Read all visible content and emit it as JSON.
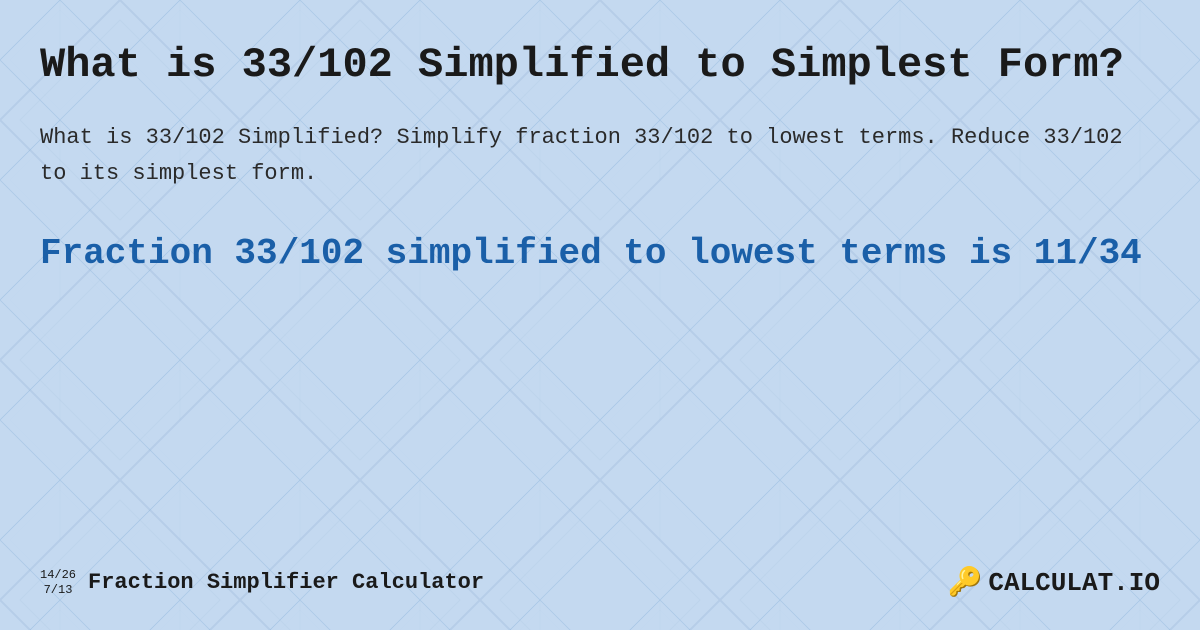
{
  "page": {
    "title": "What is 33/102 Simplified to Simplest Form?",
    "description": "What is 33/102 Simplified? Simplify fraction 33/102 to lowest terms. Reduce 33/102 to its simplest form.",
    "result": "Fraction 33/102 simplified to lowest terms is 11/34",
    "footer": {
      "fraction_top": "14/26",
      "fraction_bottom": "7/13",
      "label": "Fraction Simplifier Calculator",
      "logo_text": "CALCULAT.IO"
    }
  },
  "background": {
    "color": "#bdd6f0"
  }
}
